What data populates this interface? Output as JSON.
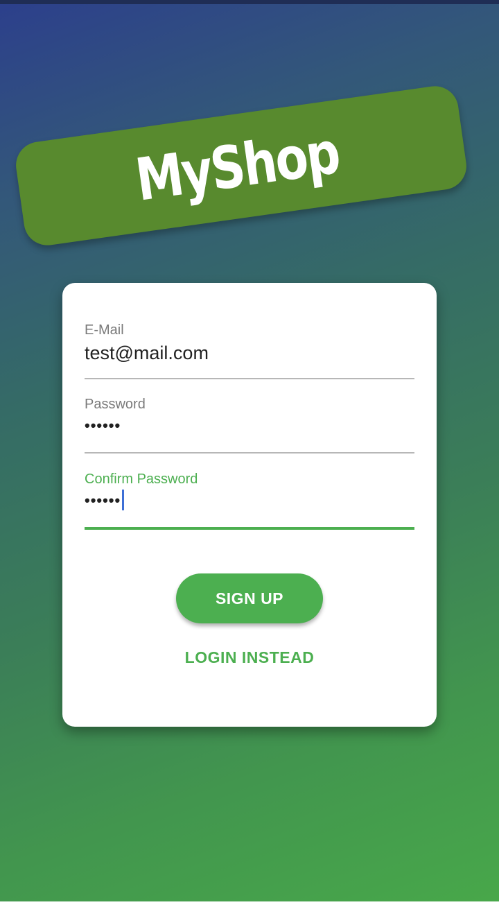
{
  "app": {
    "logo_text": "MyShop"
  },
  "form": {
    "email": {
      "label": "E-Mail",
      "value": "test@mail.com"
    },
    "password": {
      "label": "Password",
      "value": "••••••"
    },
    "confirm_password": {
      "label": "Confirm Password",
      "value": "••••••"
    }
  },
  "actions": {
    "submit_label": "SIGN UP",
    "switch_mode_label": "LOGIN INSTEAD"
  },
  "colors": {
    "accent": "#4caf50",
    "logo_banner": "#588a2e",
    "gradient_start": "#2c3f8c",
    "gradient_end": "#48a84a",
    "cursor": "#3d6fd6"
  },
  "icons": []
}
